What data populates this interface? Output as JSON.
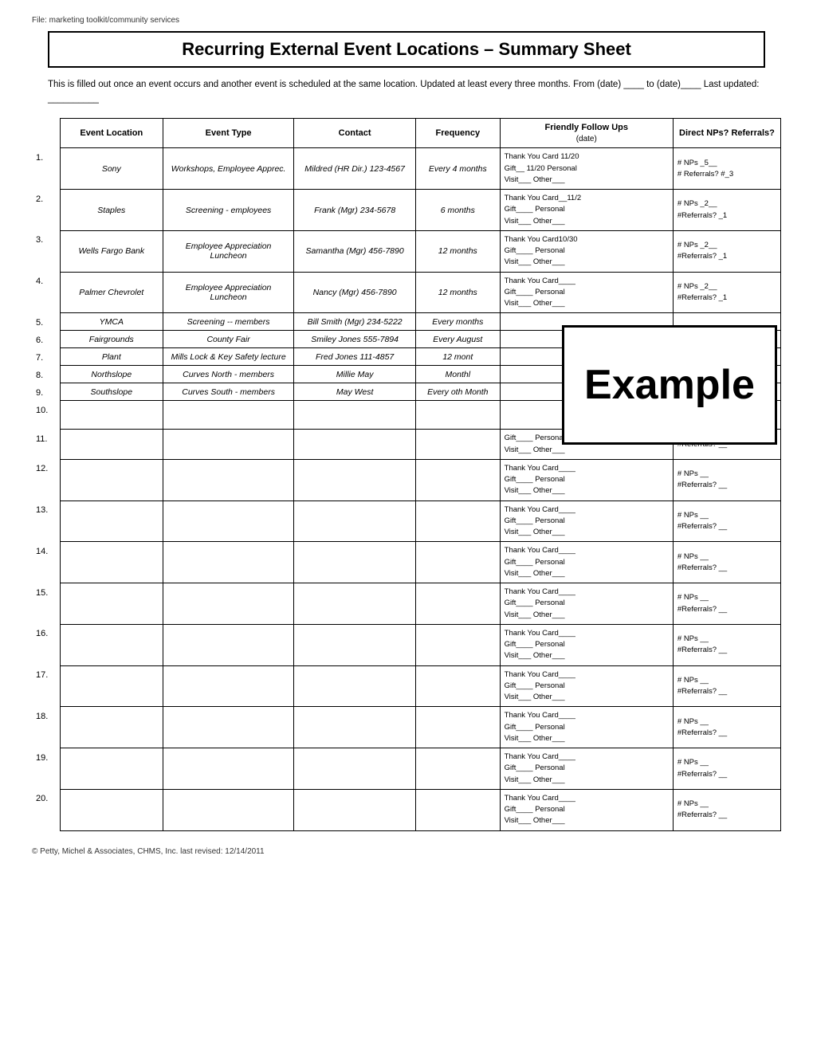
{
  "file_path": "File: marketing toolkit/community services",
  "title": "Recurring External Event Locations – Summary Sheet",
  "description": "This is filled out once an event occurs and another event is scheduled at the same location.  Updated at least every three months. From (date) ____ to (date)____  Last updated: __________",
  "headers": {
    "location": "Event Location",
    "type": "Event Type",
    "contact": "Contact",
    "frequency": "Frequency",
    "followup": "Friendly Follow Ups",
    "followup_sub": "(date)",
    "direct": "Direct NPs? Referrals?"
  },
  "rows": [
    {
      "num": "1.",
      "location": "Sony",
      "type": "Workshops, Employee Apprec.",
      "contact": "Mildred (HR Dir.) 123-4567",
      "frequency": "Every 4 months",
      "followup": "Thank You Card 11/20\nGift__ 11/20 Personal\nVisit___ Other___",
      "direct": "# NPs _5__\n# Referrals? #_3"
    },
    {
      "num": "2.",
      "location": "Staples",
      "type": "Screening - employees",
      "contact": "Frank (Mgr) 234-5678",
      "frequency": "6 months",
      "followup": "Thank You Card__11/2\nGift____ Personal\nVisit___ Other___",
      "direct": "# NPs _2__\n#Referrals? _1"
    },
    {
      "num": "3.",
      "location": "Wells Fargo Bank",
      "type": "Employee Appreciation Luncheon",
      "contact": "Samantha (Mgr) 456-7890",
      "frequency": "12 months",
      "followup": "Thank You Card10/30\nGift____ Personal\nVisit___ Other___",
      "direct": "# NPs _2__\n#Referrals? _1"
    },
    {
      "num": "4.",
      "location": "Palmer Chevrolet",
      "type": "Employee Appreciation Luncheon",
      "contact": "Nancy (Mgr) 456-7890",
      "frequency": "12 months",
      "followup": "Thank You Card____\nGift____ Personal\nVisit___ Other___",
      "direct": "# NPs _2__\n#Referrals? _1"
    },
    {
      "num": "5.",
      "location": "YMCA",
      "type": "Screening -- members",
      "contact": "Bill Smith (Mgr) 234-5222",
      "frequency": "Every months",
      "followup": "",
      "direct": ""
    },
    {
      "num": "6.",
      "location": "Fairgrounds",
      "type": "County Fair",
      "contact": "Smiley Jones 555-7894",
      "frequency": "Every August",
      "followup": "",
      "direct": ""
    },
    {
      "num": "7.",
      "location": "Plant",
      "type": "Mills Lock & Key Safety lecture",
      "contact": "Fred Jones 111-4857",
      "frequency": "12 mont",
      "followup": "",
      "direct": ""
    },
    {
      "num": "8.",
      "location": "Northslope",
      "type": "Curves North - members",
      "contact": "Millie May",
      "frequency": "Monthl",
      "followup": "",
      "direct": ""
    },
    {
      "num": "9.",
      "location": "Southslope",
      "type": "Curves South - members",
      "contact": "May West",
      "frequency": "Every oth Month",
      "followup": "",
      "direct": ""
    },
    {
      "num": "10.",
      "location": "",
      "type": "",
      "contact": "",
      "frequency": "",
      "followup": "",
      "direct": ""
    },
    {
      "num": "11.",
      "location": "",
      "type": "",
      "contact": "",
      "frequency": "",
      "followup": "Gift____ Personal\nVisit___ Other___",
      "direct": "#Referrals? __"
    },
    {
      "num": "12.",
      "location": "",
      "type": "",
      "contact": "",
      "frequency": "",
      "followup": "Thank You Card____\nGift____ Personal\nVisit___ Other___",
      "direct": "# NPs __\n#Referrals? __"
    },
    {
      "num": "13.",
      "location": "",
      "type": "",
      "contact": "",
      "frequency": "",
      "followup": "Thank You Card____\nGift____ Personal\nVisit___ Other___",
      "direct": "# NPs __\n#Referrals? __"
    },
    {
      "num": "14.",
      "location": "",
      "type": "",
      "contact": "",
      "frequency": "",
      "followup": "Thank You Card____\nGift____ Personal\nVisit___ Other___",
      "direct": "# NPs __\n#Referrals? __"
    },
    {
      "num": "15.",
      "location": "",
      "type": "",
      "contact": "",
      "frequency": "",
      "followup": "Thank You Card____\nGift____ Personal\nVisit___ Other___",
      "direct": "# NPs __\n#Referrals? __"
    },
    {
      "num": "16.",
      "location": "",
      "type": "",
      "contact": "",
      "frequency": "",
      "followup": "Thank You Card____\nGift____ Personal\nVisit___ Other___",
      "direct": "# NPs __\n#Referrals? __"
    },
    {
      "num": "17.",
      "location": "",
      "type": "",
      "contact": "",
      "frequency": "",
      "followup": "Thank You Card____\nGift____ Personal\nVisit___ Other___",
      "direct": "# NPs __\n#Referrals? __"
    },
    {
      "num": "18.",
      "location": "",
      "type": "",
      "contact": "",
      "frequency": "",
      "followup": "Thank You Card____\nGift____ Personal\nVisit___ Other___",
      "direct": "# NPs __\n#Referrals? __"
    },
    {
      "num": "19.",
      "location": "",
      "type": "",
      "contact": "",
      "frequency": "",
      "followup": "Thank You Card____\nGift____ Personal\nVisit___ Other___",
      "direct": "# NPs __\n#Referrals? __"
    },
    {
      "num": "20.",
      "location": "",
      "type": "",
      "contact": "",
      "frequency": "",
      "followup": "Thank You Card____\nGift____ Personal\nVisit___ Other___",
      "direct": "# NPs __\n#Referrals? __"
    }
  ],
  "footer": "© Petty, Michel & Associates, CHMS, Inc. last revised: 12/14/2011",
  "example_label": "Example"
}
